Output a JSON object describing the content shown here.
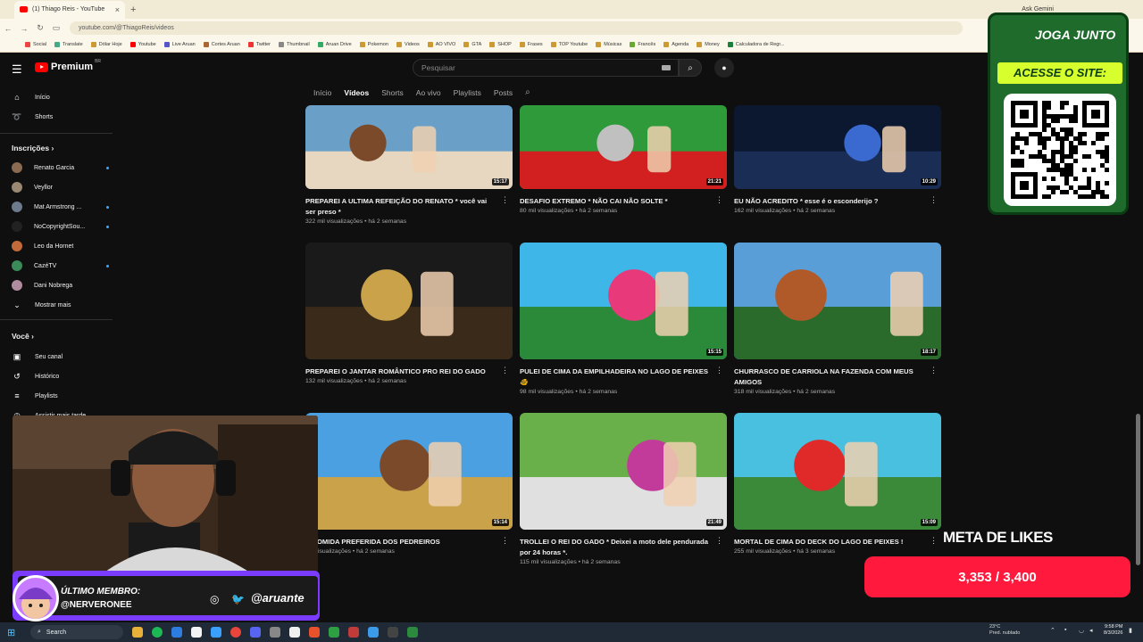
{
  "browser": {
    "tab_title": "(1) Thiago Reis - YouTube",
    "url": "youtube.com/@ThiagoReis/videos",
    "ask_gemini": "Ask Gemini",
    "bookmarks": [
      "Social",
      "Translate",
      "Dólar Hoje",
      "Youtube",
      "Live Aruan",
      "Cortes Aruan",
      "Twitter",
      "Thumbnail",
      "Aruan Drive",
      "Pokemon",
      "Videos",
      "AO VIVO",
      "GTA",
      "SHOP",
      "Frases",
      "TOP Youtube",
      "Músicas",
      "Francês",
      "Agenda",
      "Money",
      "Calculadora de Regr..."
    ]
  },
  "youtube": {
    "logo_text": "Premium",
    "logo_badge": "BR",
    "search_placeholder": "Pesquisar",
    "channel_tabs": [
      "Início",
      "Vídeos",
      "Shorts",
      "Ao vivo",
      "Playlists",
      "Posts"
    ],
    "sidebar": {
      "home": "Início",
      "shorts": "Shorts",
      "subscriptions_header": "Inscrições",
      "subscriptions": [
        "Renato Garcia",
        "Veyllor",
        "Mat Armstrong ...",
        "NoCopyrightSou...",
        "Leo da Hornet",
        "CazéTV",
        "Dani Nobrega"
      ],
      "show_more": "Mostrar mais",
      "you_header": "Você",
      "you_items": [
        "Seu canal",
        "Histórico",
        "Playlists",
        "Assistir mais tarde"
      ]
    },
    "videos": [
      {
        "title": "PREPAREI A ULTIMA REFEIÇÃO DO RENATO * você vai ser preso *",
        "views": "322 mil visualizações",
        "age": "há 2 semanas",
        "duration": "15:17"
      },
      {
        "title": "DESAFIO EXTREMO * NÃO CAI NÃO SOLTE *",
        "views": "80 mil visualizações",
        "age": "há 2 semanas",
        "duration": "21:21"
      },
      {
        "title": "EU NÃO ACREDITO * esse é o esconderijo ?",
        "views": "162 mil visualizações",
        "age": "há 2 semanas",
        "duration": "10:29"
      },
      {
        "title": "PREPAREI O JANTAR ROMÂNTICO PRO REI DO GADO",
        "views": "132 mil visualizações",
        "age": "há 2 semanas",
        "duration": ""
      },
      {
        "title": "PULEI DE CIMA DA EMPILHADEIRA NO LAGO DE PEIXES 🐠",
        "views": "98 mil visualizações",
        "age": "há 2 semanas",
        "duration": "15:15"
      },
      {
        "title": "CHURRASCO DE CARRIOLA NA FAZENDA COM MEUS AMIGOS",
        "views": "318 mil visualizações",
        "age": "há 2 semanas",
        "duration": "18:17"
      },
      {
        "title": "A COMIDA PREFERIDA DOS PEDREIROS",
        "views": "mil visualizações",
        "age": "há 2 semanas",
        "duration": "15:14"
      },
      {
        "title": "TROLLEI O REI DO GADO * Deixei a moto dele pendurada por 24 horas *.",
        "views": "115 mil visualizações",
        "age": "há 2 semanas",
        "duration": "21:49"
      },
      {
        "title": "MORTAL DE CIMA DO DECK DO LAGO DE PEIXES !",
        "views": "255 mil visualizações",
        "age": "há 3 semanas",
        "duration": "15:09"
      }
    ]
  },
  "overlay": {
    "member_label": "ÚLTIMO MEMBRO:",
    "member_name": "@NERVERONEE",
    "handle": "@aruante",
    "qr_brand": "JOGA JUNTO",
    "qr_cta": "ACESSE O SITE:",
    "goal_title": "META DE LIKES",
    "goal_value": "3,353 / 3,400",
    "goal_current": 3353,
    "goal_target": 3400
  },
  "taskbar": {
    "search": "Search",
    "weather_temp": "23°C",
    "weather_desc": "Pred. nublado",
    "time": "9:58 PM",
    "date": "8/3/2026"
  },
  "colors": {
    "yt_red": "#ff0000",
    "goal_bar": "#ff1a3d",
    "qr_green": "#1e6b2c",
    "qr_lime": "#d7ff2e",
    "member_purple": "#7b3cff"
  }
}
